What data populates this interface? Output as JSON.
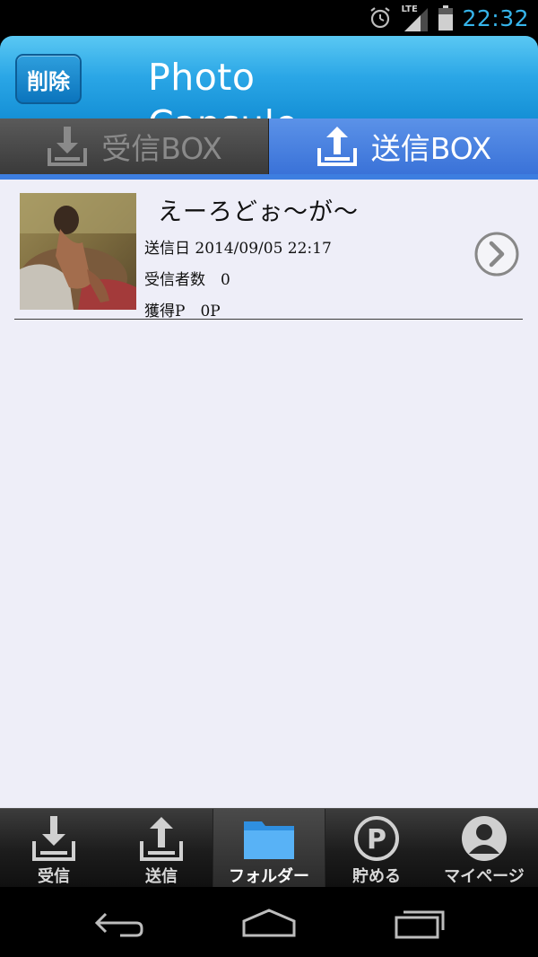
{
  "status_bar": {
    "network_label": "LTE",
    "time": "22:32",
    "icons": [
      "alarm-icon",
      "signal-icon",
      "battery-icon"
    ],
    "time_color": "#36b4ea"
  },
  "header": {
    "delete_label": "削除",
    "title": "Photo Capsule",
    "accent_color": "#2aa6e6"
  },
  "tabs": [
    {
      "label": "受信BOX",
      "icon": "download-tray-icon",
      "active": false
    },
    {
      "label": "送信BOX",
      "icon": "upload-tray-icon",
      "active": true
    }
  ],
  "list": {
    "items": [
      {
        "title": "えーろどぉ～が～",
        "sent_date": "送信日 2014/09/05 22:17",
        "recipients": "受信者数　0",
        "points": "獲得P　0P",
        "icon": "chevron-right-icon"
      }
    ]
  },
  "bottom_nav": {
    "items": [
      {
        "label": "受信",
        "icon": "download-tray-icon"
      },
      {
        "label": "送信",
        "icon": "upload-tray-icon"
      },
      {
        "label": "フォルダー",
        "icon": "folder-icon",
        "active": true
      },
      {
        "label": "貯める",
        "icon": "points-icon"
      },
      {
        "label": "マイページ",
        "icon": "user-icon"
      }
    ]
  },
  "system_nav": {
    "icons": [
      "back-icon",
      "home-icon",
      "recents-icon"
    ]
  }
}
